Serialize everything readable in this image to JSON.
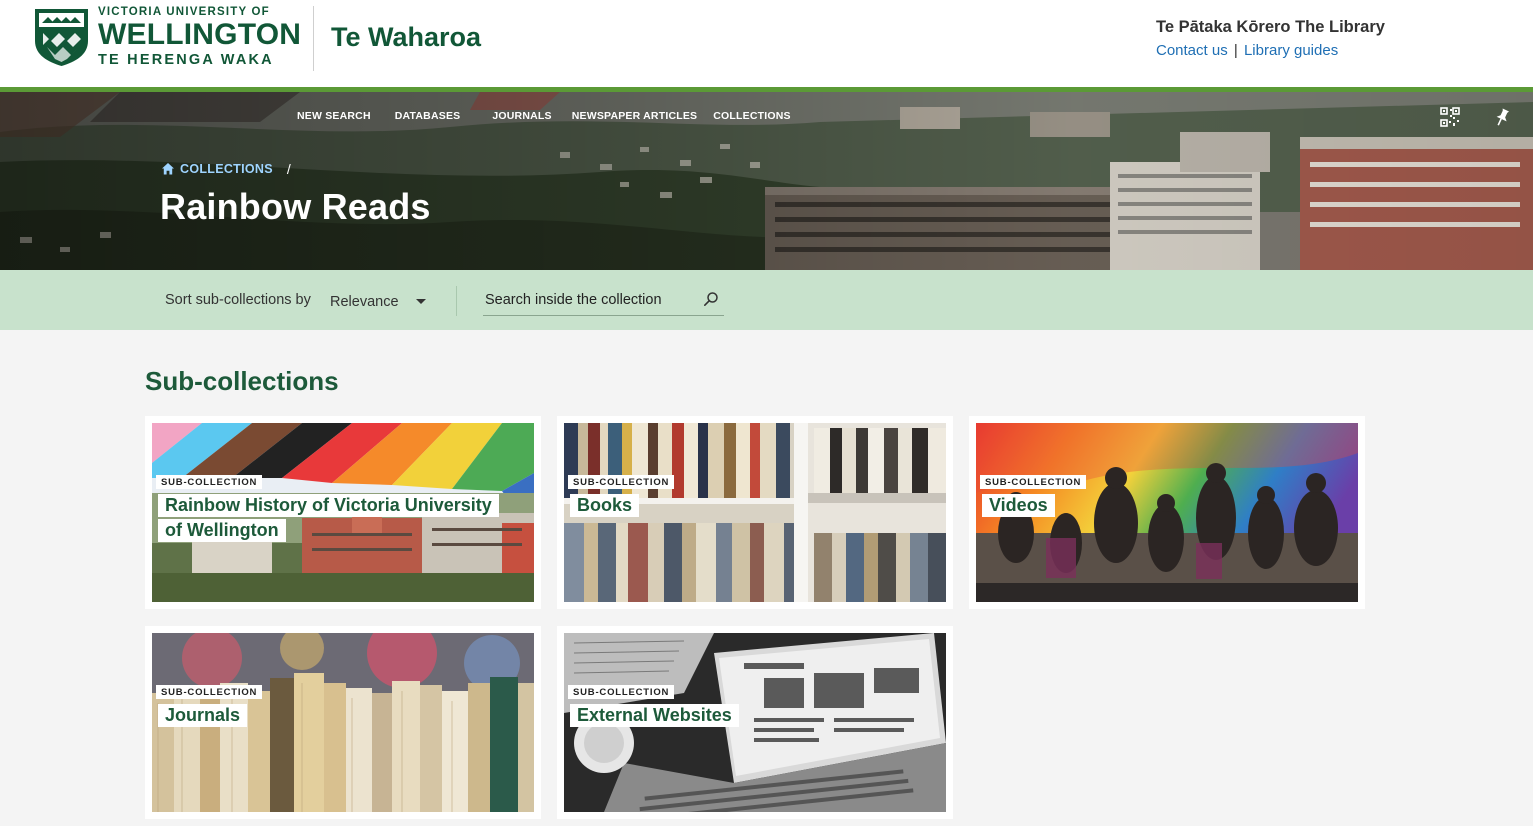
{
  "header": {
    "university": {
      "top_line": "VICTORIA UNIVERSITY OF",
      "main_line": "WELLINGTON",
      "bottom_line": "TE HERENGA WAKA"
    },
    "app_title": "Te Waharoa",
    "library_name": "Te Pātaka Kōrero The Library",
    "links": {
      "contact": "Contact us",
      "separator": "|",
      "guides": "Library guides"
    }
  },
  "nav": {
    "items": [
      "NEW SEARCH",
      "DATABASES",
      "JOURNALS",
      "NEWSPAPER ARTICLES",
      "COLLECTIONS"
    ]
  },
  "hero": {
    "breadcrumb": {
      "root": "COLLECTIONS",
      "separator": "/"
    },
    "title": "Rainbow Reads",
    "icons": [
      "qr-code-icon",
      "pin-icon"
    ]
  },
  "toolbar": {
    "sort_label": "Sort sub-collections by",
    "sort_value": "Relevance",
    "search_placeholder": "Search inside the collection"
  },
  "section": {
    "title": "Sub-collections",
    "badge": "SUB-COLLECTION",
    "cards": [
      {
        "title": "Rainbow History of Victoria University of Wellington"
      },
      {
        "title": "Books"
      },
      {
        "title": "Videos"
      },
      {
        "title": "Journals"
      },
      {
        "title": "External Websites"
      }
    ]
  },
  "colors": {
    "brand_green": "#115737",
    "accent_green": "#5b9a36",
    "toolbar_bg": "#c8e2cc",
    "link_blue": "#1f6fb4"
  }
}
